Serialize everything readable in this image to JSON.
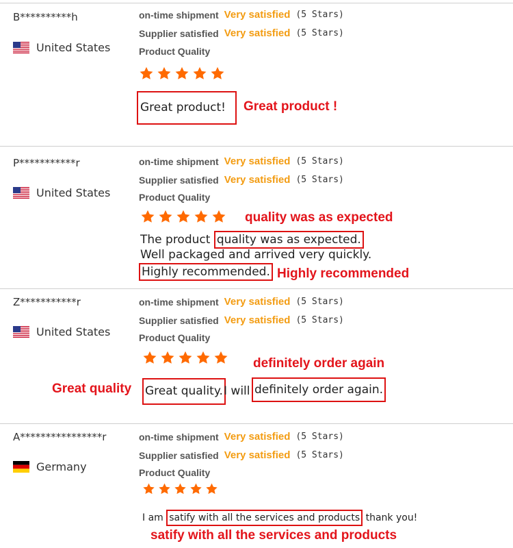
{
  "labels": {
    "ontime": "on-time shipment",
    "supplier": "Supplier satisfied",
    "product_quality": "Product Quality"
  },
  "reviews": [
    {
      "buyer": "B**********h",
      "country": "United States",
      "flag": "us",
      "ontime_value": "Very satisfied",
      "ontime_stars": "(5 Stars)",
      "supplier_value": "Very satisfied",
      "supplier_stars": "(5 Stars)",
      "rating": 5,
      "comment": "Great product!",
      "annotation": "Great product !"
    },
    {
      "buyer": "P***********r",
      "country": "United States",
      "flag": "us",
      "ontime_value": "Very satisfied",
      "ontime_stars": "(5 Stars)",
      "supplier_value": "Very satisfied",
      "supplier_stars": "(5 Stars)",
      "rating": 5,
      "comment_a": "The product ",
      "comment_b": "quality was as expected.",
      "comment_c": "Well packaged and arrived very quickly.",
      "comment_d": "Highly recommended.",
      "annotation_1": "quality was as expected",
      "annotation_2": "Highly recommended"
    },
    {
      "buyer": "Z***********r",
      "country": "United States",
      "flag": "us",
      "ontime_value": "Very satisfied",
      "ontime_stars": "(5 Stars)",
      "supplier_value": "Very satisfied",
      "supplier_stars": "(5 Stars)",
      "rating": 5,
      "comment_a": "Great quality.",
      "comment_b": " I will ",
      "comment_c": "definitely order again.",
      "annotation_1": "definitely order again",
      "annotation_2": "Great quality"
    },
    {
      "buyer": "A****************r",
      "country": "Germany",
      "flag": "de",
      "ontime_value": "Very satisfied",
      "ontime_stars": "(5 Stars)",
      "supplier_value": "Very satisfied",
      "supplier_stars": "(5 Stars)",
      "rating": 5,
      "comment_a": "I am ",
      "comment_b": "satify with all the services and products",
      "comment_c": " thank you!",
      "annotation": "satify with all the services and products"
    }
  ],
  "colors": {
    "accent": "#f39c12",
    "star": "#ff6a00",
    "annotation": "#e3141b"
  }
}
